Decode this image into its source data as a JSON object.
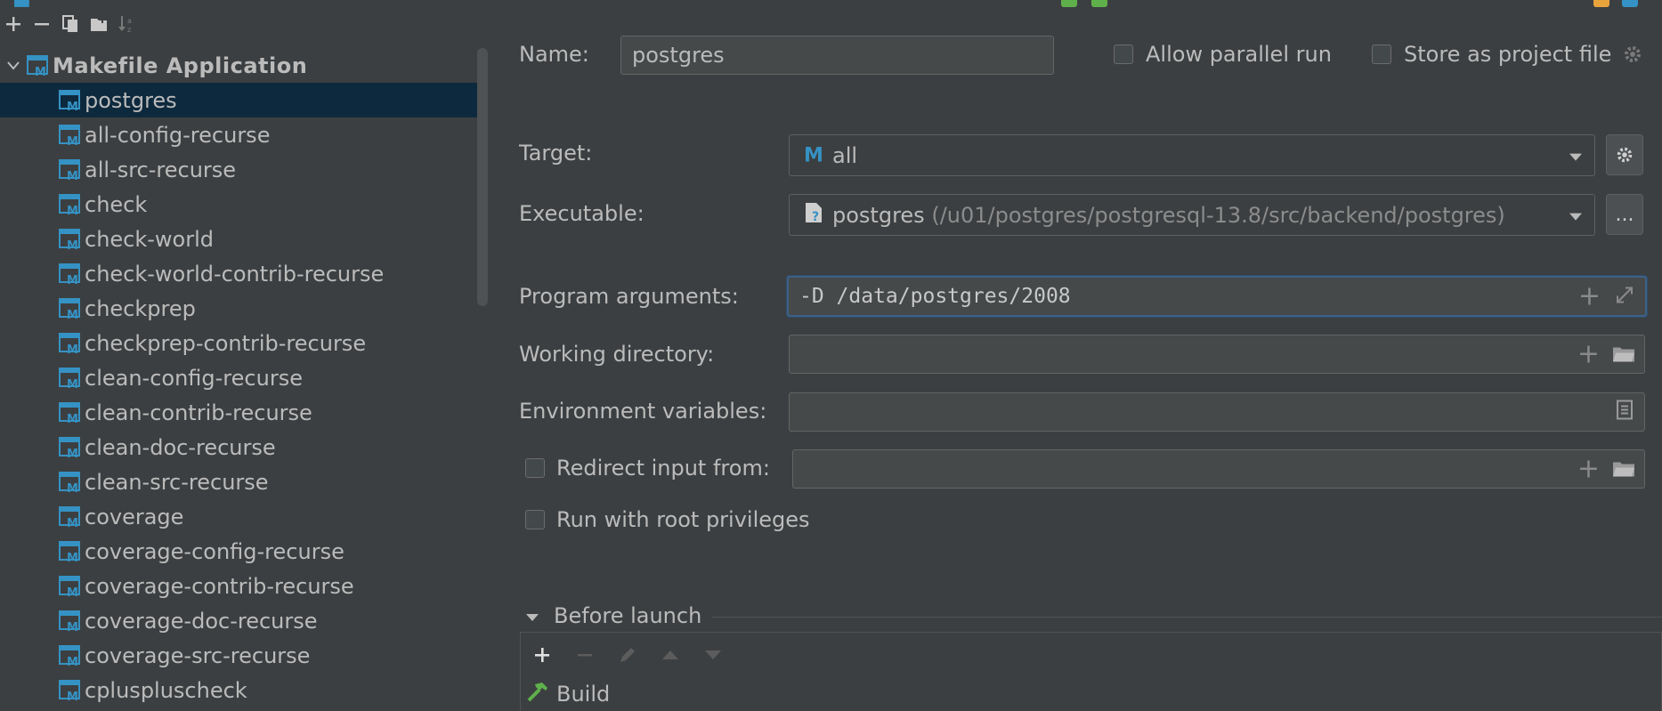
{
  "colors": {
    "background": "#3c3f41",
    "selection": "#0d293e",
    "makefile_icon": "#3592c4",
    "build_icon": "#5fb04b",
    "focus_border": "#3d6185"
  },
  "left_toolbar": {
    "icons": [
      "add-icon",
      "remove-icon",
      "copy-icon",
      "new-folder-icon",
      "sort-icon"
    ]
  },
  "tree": {
    "root_label": "Makefile Application",
    "items": [
      "postgres",
      "all-config-recurse",
      "all-src-recurse",
      "check",
      "check-world",
      "check-world-contrib-recurse",
      "checkprep",
      "checkprep-contrib-recurse",
      "clean-config-recurse",
      "clean-contrib-recurse",
      "clean-doc-recurse",
      "clean-src-recurse",
      "coverage",
      "coverage-config-recurse",
      "coverage-contrib-recurse",
      "coverage-doc-recurse",
      "coverage-src-recurse",
      "cpluspluscheck"
    ],
    "selected_index": 0
  },
  "form": {
    "name_label": "Name:",
    "name_value": "postgres",
    "allow_parallel_label": "Allow parallel run",
    "allow_parallel_checked": false,
    "store_project_label": "Store as project file",
    "store_project_checked": false,
    "target_label": "Target:",
    "target_value": "all",
    "executable_label": "Executable:",
    "executable_value": "postgres",
    "executable_path": "(/u01/postgres/postgresql-13.8/src/backend/postgres)",
    "browse_label": "...",
    "program_args_label": "Program arguments:",
    "program_args_value": "-D /data/postgres/2008",
    "working_dir_label": "Working directory:",
    "working_dir_value": "",
    "env_vars_label": "Environment variables:",
    "env_vars_value": "",
    "redirect_label": "Redirect input from:",
    "redirect_checked": false,
    "redirect_value": "",
    "root_priv_label": "Run with root privileges",
    "root_priv_checked": false
  },
  "before_launch": {
    "title": "Before launch",
    "toolbar_icons": [
      "add-icon",
      "remove-icon",
      "edit-icon",
      "move-up-icon",
      "move-down-icon"
    ],
    "items": [
      "Build"
    ]
  }
}
